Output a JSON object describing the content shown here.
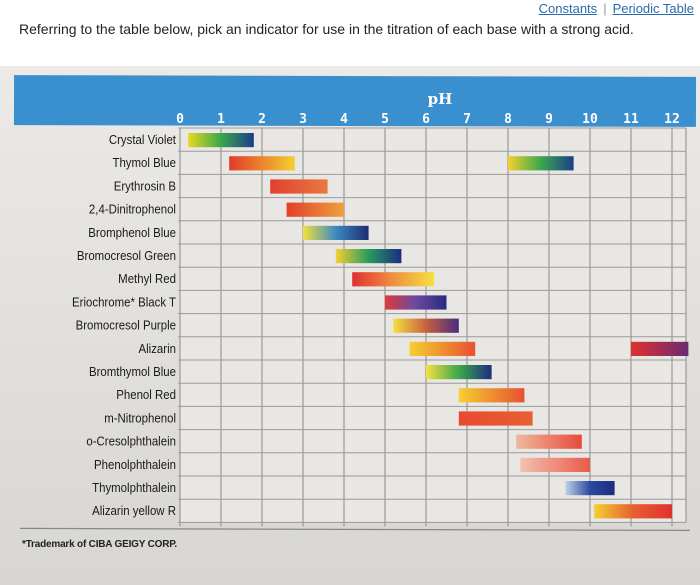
{
  "top_links": {
    "constants": "Constants",
    "separator": "|",
    "periodic_table": "Periodic Table"
  },
  "question": "Referring to the table below, pick an indicator for use in the titration of each base with a strong acid.",
  "footnote": "*Trademark of CIBA GEIGY CORP.",
  "chart_data": {
    "type": "table",
    "title": "",
    "xlabel": "pH",
    "ylabel": "",
    "xlim": [
      0,
      12.5
    ],
    "x_ticks": [
      0,
      1,
      2,
      3,
      4,
      5,
      6,
      7,
      8,
      9,
      10,
      11,
      12
    ],
    "grid": true,
    "legend": "none",
    "header_color": "#3a8fce",
    "rows": [
      {
        "name": "Crystal Violet",
        "ranges": [
          {
            "from": 0.2,
            "to": 1.8,
            "colors": [
              "#e8d820",
              "#3aa84a",
              "#1c3c8c"
            ]
          }
        ]
      },
      {
        "name": "Thymol Blue",
        "ranges": [
          {
            "from": 1.2,
            "to": 2.8,
            "colors": [
              "#e03a2a",
              "#f5d030"
            ]
          },
          {
            "from": 8.0,
            "to": 9.6,
            "colors": [
              "#f5d030",
              "#3aa84a",
              "#1c3c8c"
            ]
          }
        ]
      },
      {
        "name": "Erythrosin B",
        "ranges": [
          {
            "from": 2.2,
            "to": 3.6,
            "colors": [
              "#e04030",
              "#e87a40"
            ]
          }
        ]
      },
      {
        "name": "2,4-Dinitrophenol",
        "ranges": [
          {
            "from": 2.6,
            "to": 4.0,
            "colors": [
              "#e0402a",
              "#f0a040"
            ]
          }
        ]
      },
      {
        "name": "Bromphenol Blue",
        "ranges": [
          {
            "from": 3.0,
            "to": 4.6,
            "colors": [
              "#f5e040",
              "#3a8ac0",
              "#1c2c70"
            ]
          }
        ]
      },
      {
        "name": "Bromocresol Green",
        "ranges": [
          {
            "from": 3.8,
            "to": 5.4,
            "colors": [
              "#f5d030",
              "#2a9a60",
              "#1c2c80"
            ]
          }
        ]
      },
      {
        "name": "Methyl Red",
        "ranges": [
          {
            "from": 4.2,
            "to": 6.2,
            "colors": [
              "#e03030",
              "#f09040",
              "#f5e040"
            ]
          }
        ]
      },
      {
        "name": "Eriochrome* Black T",
        "ranges": [
          {
            "from": 5.0,
            "to": 6.5,
            "colors": [
              "#e03a3a",
              "#6a4aa0",
              "#2a2a80"
            ]
          }
        ]
      },
      {
        "name": "Bromocresol Purple",
        "ranges": [
          {
            "from": 5.2,
            "to": 6.8,
            "colors": [
              "#f5e040",
              "#c86040",
              "#4a2a80"
            ]
          }
        ]
      },
      {
        "name": "Alizarin",
        "ranges": [
          {
            "from": 5.6,
            "to": 7.2,
            "colors": [
              "#f5d030",
              "#e85030"
            ]
          },
          {
            "from": 11.0,
            "to": 12.4,
            "colors": [
              "#e03030",
              "#6a2a70"
            ]
          }
        ]
      },
      {
        "name": "Bromthymol Blue",
        "ranges": [
          {
            "from": 6.0,
            "to": 7.6,
            "colors": [
              "#f5e040",
              "#3aa84a",
              "#1c2c80"
            ]
          }
        ]
      },
      {
        "name": "Phenol Red",
        "ranges": [
          {
            "from": 6.8,
            "to": 8.4,
            "colors": [
              "#f5d030",
              "#e85030"
            ]
          }
        ]
      },
      {
        "name": "m-Nitrophenol",
        "ranges": [
          {
            "from": 6.8,
            "to": 8.6,
            "colors": [
              "#e84a30",
              "#e86030"
            ]
          }
        ]
      },
      {
        "name": "o-Cresolphthalein",
        "ranges": [
          {
            "from": 8.2,
            "to": 9.8,
            "colors": [
              "#f0b8a0",
              "#e84a3a"
            ]
          }
        ]
      },
      {
        "name": "Phenolphthalein",
        "ranges": [
          {
            "from": 8.3,
            "to": 10.0,
            "colors": [
              "#f5c0b0",
              "#e85a4a"
            ]
          }
        ]
      },
      {
        "name": "Thymolphthalein",
        "ranges": [
          {
            "from": 9.4,
            "to": 10.6,
            "colors": [
              "#c0d0e8",
              "#2a4aa0",
              "#1c2c80"
            ]
          }
        ]
      },
      {
        "name": "Alizarin yellow R",
        "ranges": [
          {
            "from": 10.1,
            "to": 12.0,
            "colors": [
              "#f5d030",
              "#e86030",
              "#e03030"
            ]
          }
        ]
      }
    ]
  }
}
